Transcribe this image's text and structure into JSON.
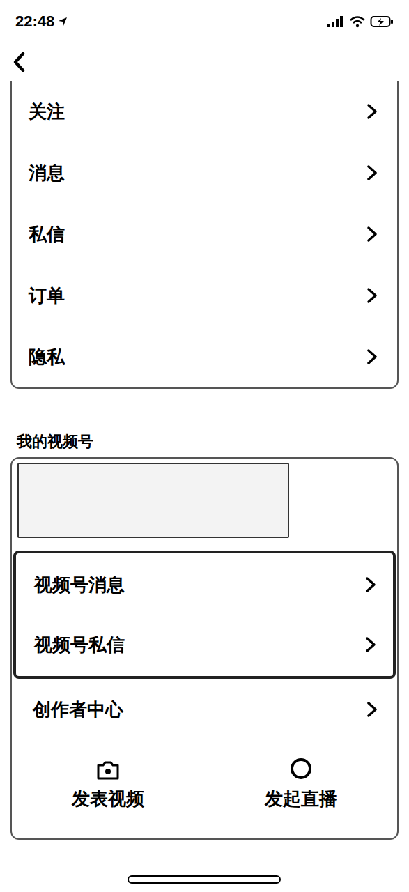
{
  "status_bar": {
    "time": "22:48"
  },
  "menu": {
    "items": [
      {
        "label": "关注"
      },
      {
        "label": "消息"
      },
      {
        "label": "私信"
      },
      {
        "label": "订单"
      },
      {
        "label": "隐私"
      }
    ]
  },
  "channel": {
    "section_title": "我的视频号",
    "items": [
      {
        "label": "视频号消息",
        "highlighted": true
      },
      {
        "label": "视频号私信",
        "highlighted": true
      },
      {
        "label": "创作者中心",
        "highlighted": false
      }
    ],
    "actions": [
      {
        "label": "发表视频",
        "kind": "camera"
      },
      {
        "label": "发起直播",
        "kind": "live"
      }
    ]
  }
}
